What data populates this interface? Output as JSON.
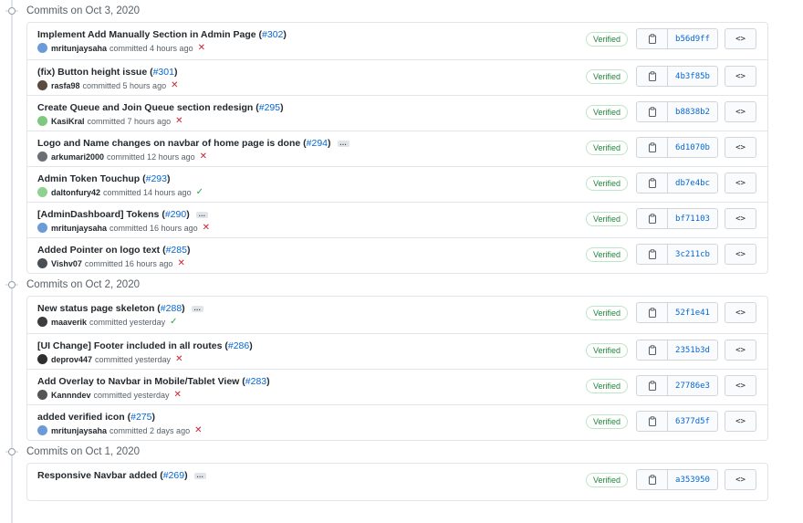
{
  "groups": [
    {
      "label": "Commits on Oct 3, 2020",
      "commits": [
        {
          "title": "Implement Add Manually Section in Admin Page",
          "pr": "#302",
          "ellipsis": false,
          "author": "mritunjaysaha",
          "time": "committed 4 hours ago",
          "status": "fail",
          "sha": "b56d9ff",
          "avatar_color": "#6a9bd8"
        },
        {
          "title": "(fix) Button height issue",
          "pr": "#301",
          "ellipsis": false,
          "author": "rasfa98",
          "time": "committed 5 hours ago",
          "status": "fail",
          "sha": "4b3f85b",
          "avatar_color": "#5b4a3f"
        },
        {
          "title": "Create Queue and Join Queue section redesign",
          "pr": "#295",
          "ellipsis": false,
          "author": "KasiKral",
          "time": "committed 7 hours ago",
          "status": "fail",
          "sha": "b8838b2",
          "avatar_color": "#7fc97f"
        },
        {
          "title": "Logo and Name changes on navbar of home page is done",
          "pr": "#294",
          "ellipsis": true,
          "author": "arkumari2000",
          "time": "committed 12 hours ago",
          "status": "fail",
          "sha": "6d1070b",
          "avatar_color": "#6b6f74"
        },
        {
          "title": "Admin Token Touchup",
          "pr": "#293",
          "ellipsis": false,
          "author": "daltonfury42",
          "time": "committed 14 hours ago",
          "status": "ok",
          "sha": "db7e4bc",
          "avatar_color": "#8fd18f"
        },
        {
          "title": "[AdminDashboard] Tokens",
          "pr": "#290",
          "ellipsis": true,
          "author": "mritunjaysaha",
          "time": "committed 16 hours ago",
          "status": "fail",
          "sha": "bf71103",
          "avatar_color": "#6a9bd8"
        },
        {
          "title": "Added Pointer on logo text",
          "pr": "#285",
          "ellipsis": false,
          "author": "Vishv07",
          "time": "committed 16 hours ago",
          "status": "fail",
          "sha": "3c211cb",
          "avatar_color": "#4a4f55"
        }
      ]
    },
    {
      "label": "Commits on Oct 2, 2020",
      "commits": [
        {
          "title": "New status page skeleton",
          "pr": "#288",
          "ellipsis": true,
          "author": "maaverik",
          "time": "committed yesterday",
          "status": "ok",
          "sha": "52f1e41",
          "avatar_color": "#3d3d3d"
        },
        {
          "title": "[UI Change] Footer included in all routes",
          "pr": "#286",
          "ellipsis": false,
          "author": "deprov447",
          "time": "committed yesterday",
          "status": "fail",
          "sha": "2351b3d",
          "avatar_color": "#2f2f2f"
        },
        {
          "title": "Add Overlay to Navbar in Mobile/Tablet View",
          "pr": "#283",
          "ellipsis": false,
          "author": "Kannndev",
          "time": "committed yesterday",
          "status": "fail",
          "sha": "27786e3",
          "avatar_color": "#555555"
        },
        {
          "title": "added verified icon",
          "pr": "#275",
          "ellipsis": false,
          "author": "mritunjaysaha",
          "time": "committed 2 days ago",
          "status": "fail",
          "sha": "6377d5f",
          "avatar_color": "#6a9bd8"
        }
      ]
    },
    {
      "label": "Commits on Oct 1, 2020",
      "commits": [
        {
          "title": "Responsive Navbar added",
          "pr": "#269",
          "ellipsis": true,
          "author": "",
          "time": "",
          "status": "none",
          "sha": "a353950",
          "avatar_color": "#6a9bd8"
        }
      ]
    }
  ],
  "labels": {
    "verified": "Verified",
    "ellipsis": "…",
    "browse": "<>",
    "status_fail": "✕",
    "status_ok": "✓"
  }
}
